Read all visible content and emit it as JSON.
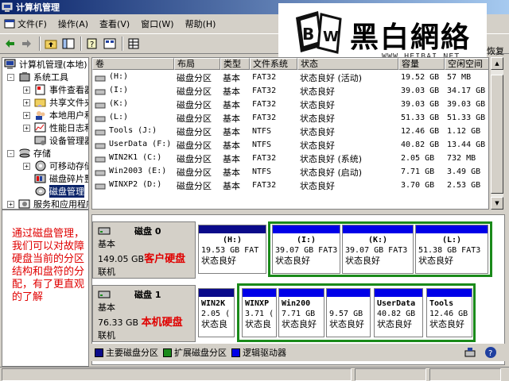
{
  "window": {
    "title": "计算机管理",
    "title_partial": "恢复"
  },
  "menu": [
    {
      "label": "文件(F)"
    },
    {
      "label": "操作(A)"
    },
    {
      "label": "查看(V)"
    },
    {
      "label": "窗口(W)"
    },
    {
      "label": "帮助(H)"
    }
  ],
  "watermark": {
    "brand": "黑白網絡",
    "url": "WWW.HEIBAI.NET"
  },
  "tree": {
    "root": "计算机管理(本地)",
    "system_tools": "系统工具",
    "event_viewer": "事件查看器",
    "shared_folders": "共享文件夹",
    "local_users": "本地用户和组",
    "perf_logs": "性能日志和警报",
    "device_manager": "设备管理器",
    "storage": "存储",
    "removable": "可移动存储",
    "defrag": "磁盘碎片整理程序",
    "disk_mgmt": "磁盘管理",
    "services": "服务和应用程序"
  },
  "annotation": "通过磁盘管理，我们可以对故障硬盘当前的分区结构和盘符的分配，有了更直观的了解",
  "volumes": {
    "headers": [
      "卷",
      "布局",
      "类型",
      "文件系统",
      "状态",
      "容量",
      "空闲空间"
    ],
    "rows": [
      [
        "(H:)",
        "磁盘分区",
        "基本",
        "FAT32",
        "状态良好 (活动)",
        "19.52 GB",
        "57 MB"
      ],
      [
        "(I:)",
        "磁盘分区",
        "基本",
        "FAT32",
        "状态良好",
        "39.03 GB",
        "34.17 GB"
      ],
      [
        "(K:)",
        "磁盘分区",
        "基本",
        "FAT32",
        "状态良好",
        "39.03 GB",
        "39.03 GB"
      ],
      [
        "(L:)",
        "磁盘分区",
        "基本",
        "FAT32",
        "状态良好",
        "51.33 GB",
        "51.33 GB"
      ],
      [
        "Tools (J:)",
        "磁盘分区",
        "基本",
        "NTFS",
        "状态良好",
        "12.46 GB",
        "1.12 GB"
      ],
      [
        "UserData (F:)",
        "磁盘分区",
        "基本",
        "NTFS",
        "状态良好",
        "40.82 GB",
        "13.44 GB"
      ],
      [
        "WIN2K1 (C:)",
        "磁盘分区",
        "基本",
        "FAT32",
        "状态良好 (系统)",
        "2.05 GB",
        "732 MB"
      ],
      [
        "Win2003 (E:)",
        "磁盘分区",
        "基本",
        "NTFS",
        "状态良好 (启动)",
        "7.71 GB",
        "3.49 GB"
      ],
      [
        "WINXP2 (D:)",
        "磁盘分区",
        "基本",
        "FAT32",
        "状态良好",
        "3.70 GB",
        "2.53 GB"
      ]
    ]
  },
  "disk0": {
    "name": "磁盘 0",
    "type": "基本",
    "size": "149.05 GB",
    "status": "联机",
    "note": "客户硬盘",
    "parts": [
      {
        "label": "(H:)",
        "size": "19.53 GB FAT",
        "state": "状态良好"
      },
      {
        "label": "(I:)",
        "size": "39.07 GB FAT3",
        "state": "状态良好"
      },
      {
        "label": "(K:)",
        "size": "39.07 GB FAT3",
        "state": "状态良好"
      },
      {
        "label": "(L:)",
        "size": "51.38 GB FAT3",
        "state": "状态良好"
      }
    ]
  },
  "disk1": {
    "name": "磁盘 1",
    "type": "基本",
    "size": "76.33 GB",
    "status": "联机",
    "note": "本机硬盘",
    "parts": [
      {
        "label": "WIN2K",
        "size": "2.05 (",
        "state": "状态良"
      },
      {
        "label": "WINXP",
        "size": "3.71 (",
        "state": "状态良"
      },
      {
        "label": "Win200",
        "size": "7.71 GB",
        "state": "状态良好"
      },
      {
        "label": "",
        "size": "9.57 GB",
        "state": "状态良好"
      },
      {
        "label": "UserData",
        "size": "40.82 GB",
        "state": "状态良好"
      },
      {
        "label": "Tools",
        "size": "12.46 GB",
        "state": "状态良好"
      }
    ]
  },
  "legend": {
    "primary": "主要磁盘分区",
    "extended": "扩展磁盘分区",
    "logical": "逻辑驱动器",
    "colors": {
      "primary": "#0a0a8a",
      "extended": "#1a8a1a",
      "logical": "#0000e8"
    }
  }
}
